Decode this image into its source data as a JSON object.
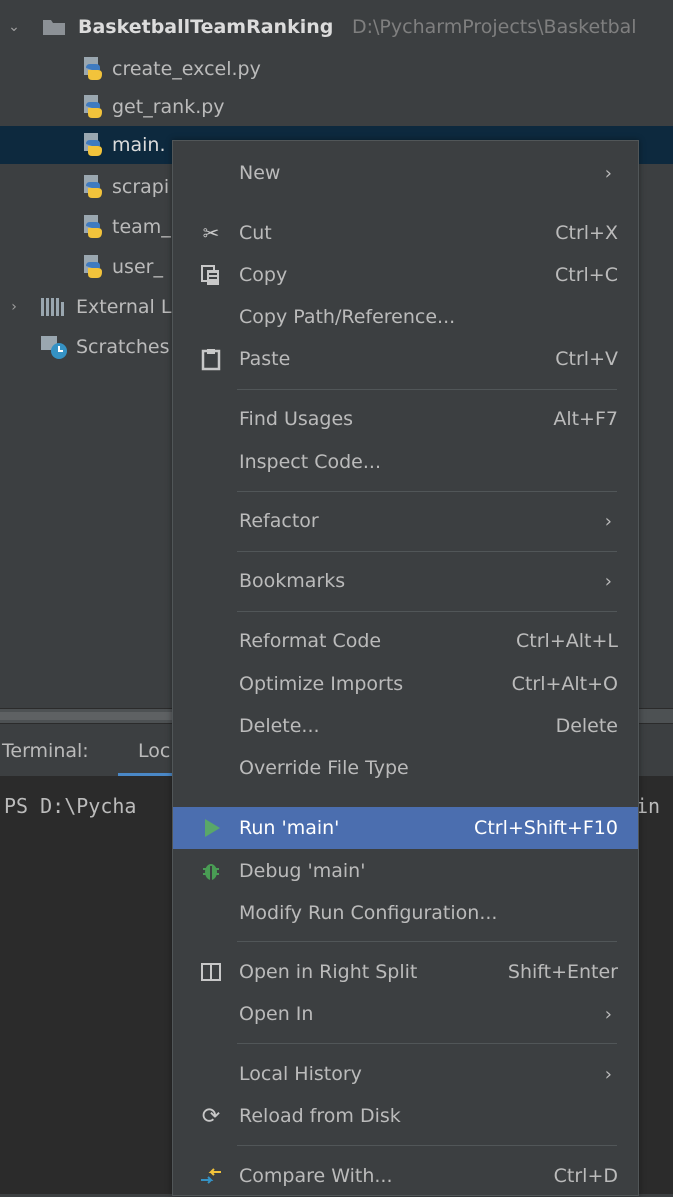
{
  "project": {
    "root_name": "BasketballTeamRanking",
    "root_path": "D:\\PycharmProjects\\Basketbal",
    "files": [
      "create_excel.py",
      "get_rank.py",
      "main.",
      "scrapi",
      "team_",
      "user_"
    ],
    "external_libraries": "External L",
    "scratches": "Scratches"
  },
  "terminal": {
    "tab_label": "Terminal:",
    "tab_local": "Loc",
    "prompt": "PS D:\\Pycha",
    "tail": "in"
  },
  "menu": {
    "new": {
      "label": "New"
    },
    "cut": {
      "label": "Cut",
      "shortcut": "Ctrl+X"
    },
    "copy": {
      "label": "Copy",
      "shortcut": "Ctrl+C"
    },
    "copy_path": {
      "label": "Copy Path/Reference..."
    },
    "paste": {
      "label": "Paste",
      "shortcut": "Ctrl+V"
    },
    "find_usages": {
      "label": "Find Usages",
      "shortcut": "Alt+F7"
    },
    "inspect_code": {
      "label": "Inspect Code..."
    },
    "refactor": {
      "label": "Refactor"
    },
    "bookmarks": {
      "label": "Bookmarks"
    },
    "reformat_code": {
      "label": "Reformat Code",
      "shortcut": "Ctrl+Alt+L"
    },
    "optimize_imports": {
      "label": "Optimize Imports",
      "shortcut": "Ctrl+Alt+O"
    },
    "delete": {
      "label": "Delete...",
      "shortcut": "Delete"
    },
    "override_file_type": {
      "label": "Override File Type"
    },
    "run_main": {
      "label": "Run 'main'",
      "shortcut": "Ctrl+Shift+F10"
    },
    "debug_main": {
      "label": "Debug 'main'"
    },
    "modify_run_config": {
      "label": "Modify Run Configuration..."
    },
    "open_right_split": {
      "label": "Open in Right Split",
      "shortcut": "Shift+Enter"
    },
    "open_in": {
      "label": "Open In"
    },
    "local_history": {
      "label": "Local History"
    },
    "reload_from_disk": {
      "label": "Reload from Disk"
    },
    "compare_with": {
      "label": "Compare With...",
      "shortcut": "Ctrl+D"
    }
  },
  "icons": {
    "folder": "folder-icon",
    "python_file": "python-file-icon",
    "libraries": "libraries-icon",
    "scratches": "scratches-icon",
    "cut": "scissors-icon",
    "copy": "copy-icon",
    "paste": "clipboard-icon",
    "run": "run-triangle-icon",
    "debug": "bug-icon",
    "split": "split-icon",
    "reload": "reload-icon",
    "compare": "compare-arrows-icon",
    "submenu": "chevron-right-icon"
  },
  "colors": {
    "menu_highlight": "#4b6eaf",
    "selected_row": "#0d293e",
    "run_green": "#59a869",
    "debug_green": "#499c54"
  }
}
